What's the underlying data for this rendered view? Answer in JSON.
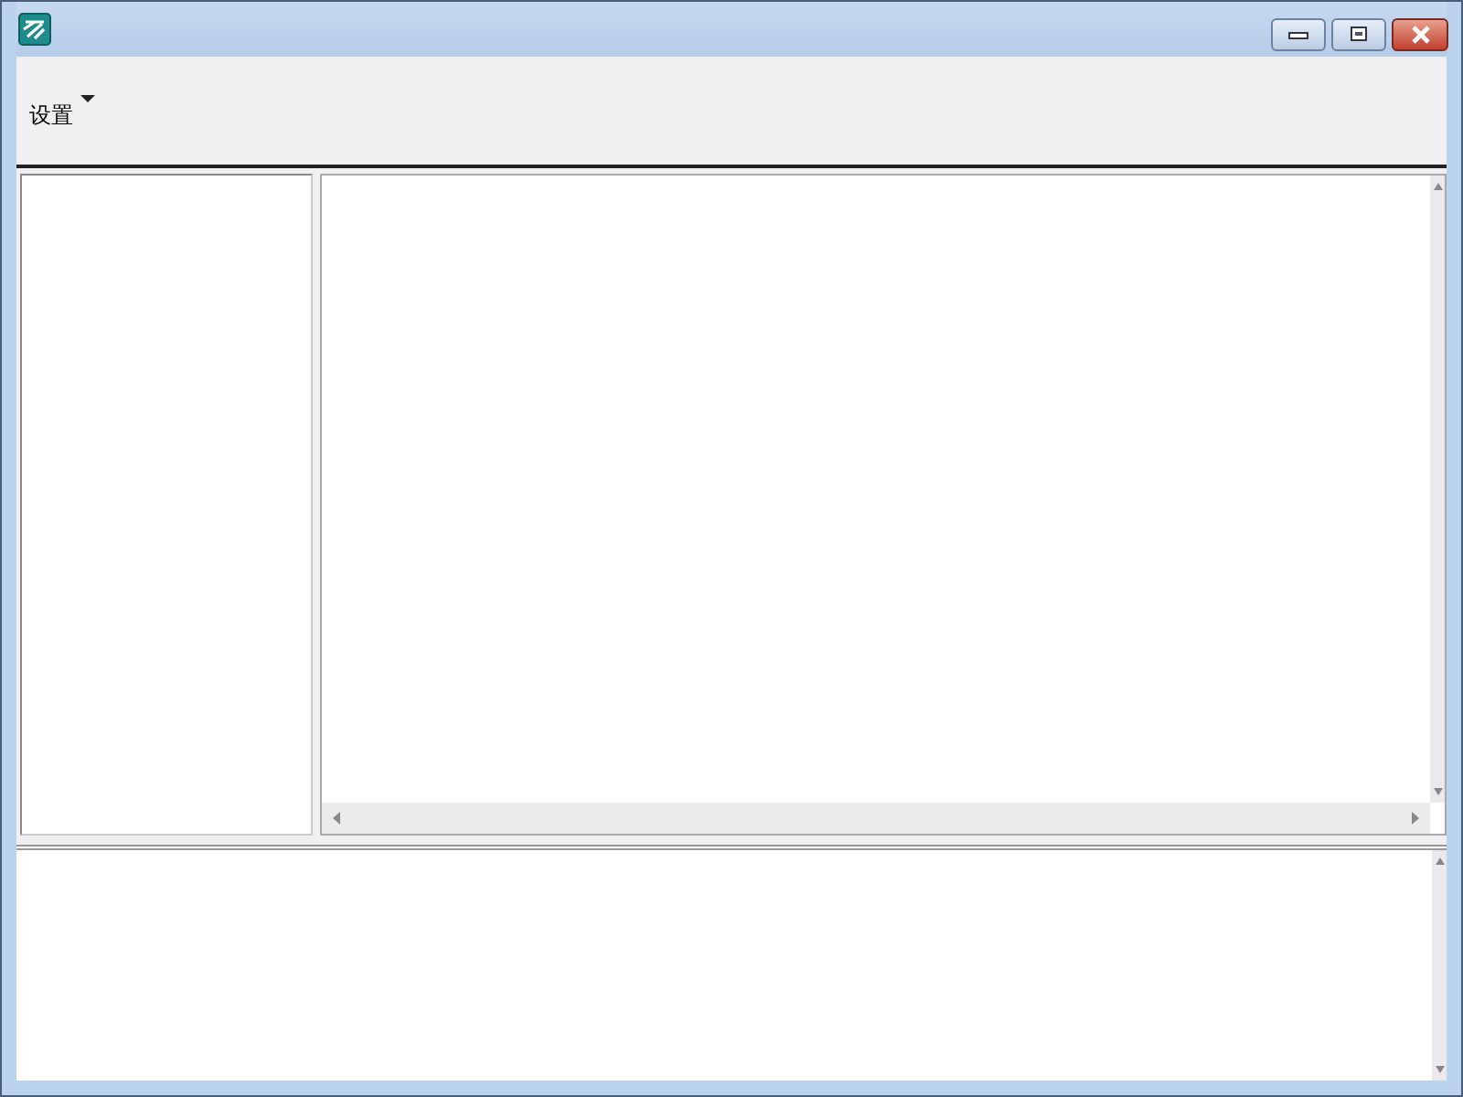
{
  "toolbar": {
    "menu": {
      "label": "设置"
    }
  }
}
